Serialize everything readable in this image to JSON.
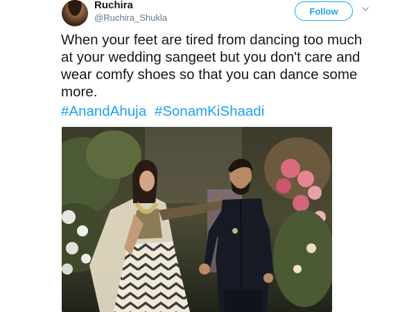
{
  "user": {
    "display_name": "Ruchira",
    "handle": "@Ruchira_Shukla",
    "avatar_icon": "user-avatar"
  },
  "actions": {
    "follow_label": "Follow",
    "more_icon": "chevron-down-icon"
  },
  "tweet": {
    "text": "When your feet are tired from dancing too much at your wedding sangeet but you don't care and wear comfy shoes so that you can dance some more.",
    "hashtags": [
      "#AnandAhuja",
      "#SonamKiShaadi"
    ]
  },
  "colors": {
    "accent": "#1da1f2",
    "text": "#14171a",
    "secondary": "#657786"
  }
}
